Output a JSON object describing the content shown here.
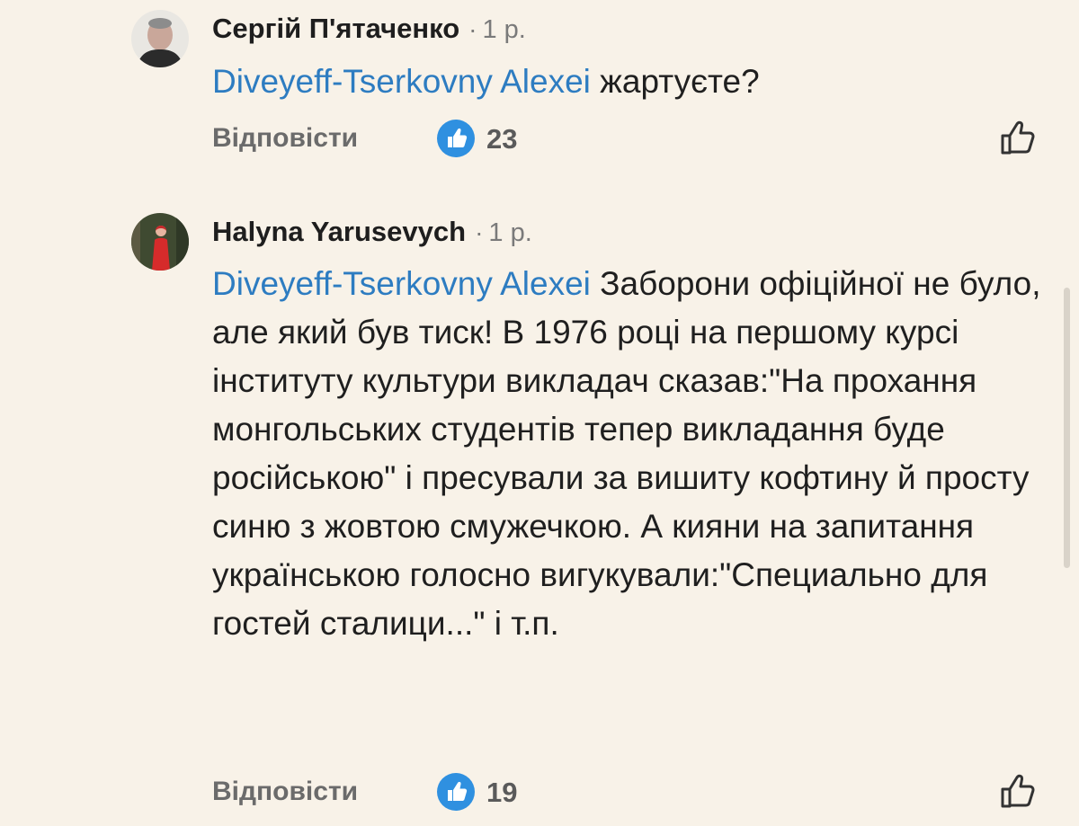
{
  "comments": [
    {
      "author": "Сергій П'ятаченко",
      "separator": "·",
      "time": "1 р.",
      "mention": "Diveyeff-Tserkovny Alexei",
      "text": " жартуєте?",
      "reply_label": "Відповісти",
      "likes": "23",
      "avatar_icon": "avatar-photo-man"
    },
    {
      "author": "Halyna Yarusevych",
      "separator": "·",
      "time": "1 р.",
      "mention": "Diveyeff-Tserkovny Alexei",
      "text": " Заборони офіційної не було, але який був тиск! В 1976 році на першому курсі інституту культури викладач сказав:\"На прохання монгольських студентів тепер викладання буде російською\" і пресували за вишиту кофтину й просту синю з жовтою смужечкою. А кияни на запитання українською голосно вигукували:\"Специально для гостей сталици...\" і т.п.",
      "reply_label": "Відповісти",
      "likes": "19",
      "avatar_icon": "avatar-photo-woman-in-red"
    }
  ],
  "colors": {
    "background": "#f8f2e8",
    "mention": "#2d7cc1",
    "like_badge": "#2f90e0"
  }
}
